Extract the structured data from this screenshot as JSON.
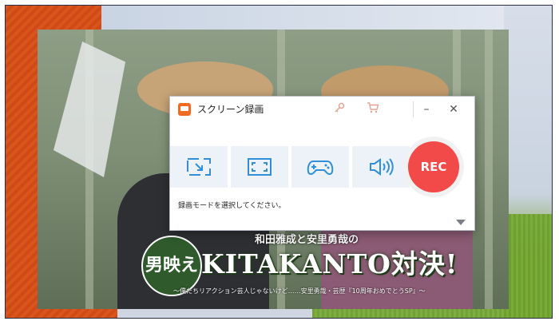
{
  "window": {
    "title": "スクリーン録画",
    "minimize_symbol": "–",
    "close_symbol": "✕"
  },
  "modes": [
    {
      "name": "region",
      "icon": "region-select-icon"
    },
    {
      "name": "fullscreen",
      "icon": "fullscreen-icon"
    },
    {
      "name": "game",
      "icon": "gamepad-icon"
    },
    {
      "name": "audio",
      "icon": "speaker-icon"
    }
  ],
  "rec_label": "REC",
  "hint_text": "録画モードを選択してください。",
  "background": {
    "logo_circle": "男映え",
    "logo_subtitle": "和田雅成と安里勇哉の",
    "logo_title": "KITAKANTO対決!",
    "logo_tagline": "〜僕たちリアクション芸人じゃないけど……安里勇哉・芸歴『10周年おめでとうSP』〜"
  },
  "colors": {
    "accent": "#f24a49",
    "icon_blue": "#2f8fd8",
    "app_icon": "#f36b23"
  }
}
